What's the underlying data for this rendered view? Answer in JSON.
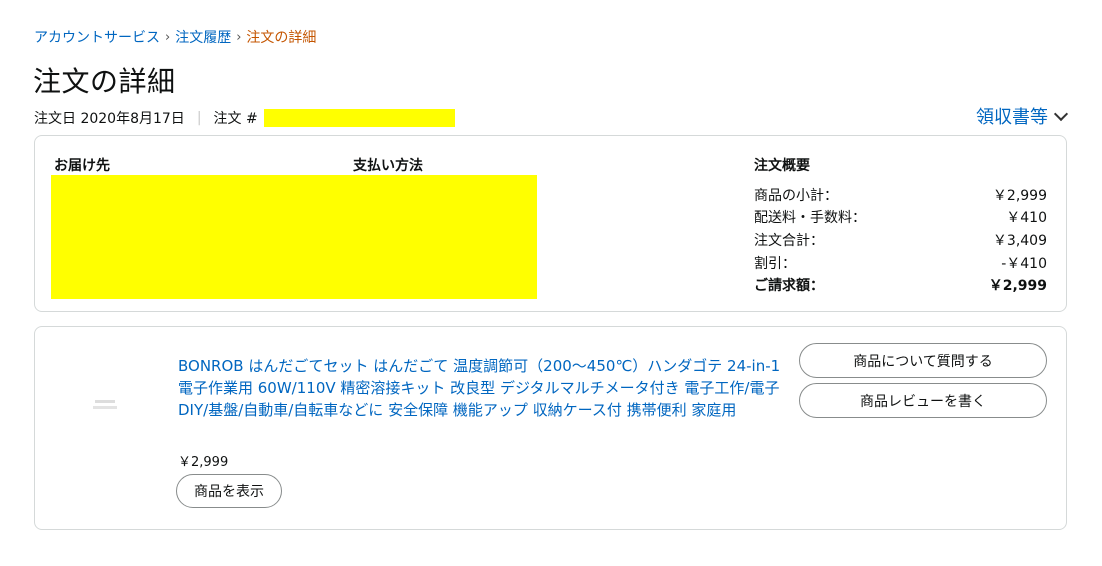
{
  "breadcrumb": {
    "items": [
      "アカウントサービス",
      "注文履歴"
    ],
    "current": "注文の詳細",
    "separator": "›"
  },
  "page": {
    "title": "注文の詳細",
    "order_date": "注文日 2020年8月17日",
    "divider": "|",
    "order_number_label": "注文 #",
    "receipt_label": "領収書等"
  },
  "summary": {
    "shipping_address_label": "お届け先",
    "payment_method_label": "支払い方法",
    "order_summary_label": "注文概要",
    "rows": [
      {
        "label": "商品の小計：",
        "value": "￥2,999"
      },
      {
        "label": "配送料・手数料：",
        "value": "￥410"
      },
      {
        "label": "注文合計：",
        "value": "￥3,409"
      },
      {
        "label": "割引：",
        "value": "-￥410"
      },
      {
        "label": "ご請求額：",
        "value": "￥2,999"
      }
    ]
  },
  "item": {
    "title": "BONROB はんだごてセット はんだごて 温度調節可（200～450℃）ハンダゴテ 24-in-1 電子作業用 60W/110V 精密溶接キット 改良型 デジタルマルチメータ付き 電子工作/電子DIY/基盤/自動車/自転車などに 安全保障 機能アップ 収納ケース付 携帯便利 家庭用",
    "price": "￥2,999",
    "view_button": "商品を表示",
    "question_button": "商品について質問する",
    "review_button": "商品レビューを書く"
  },
  "colors": {
    "link": "#0066c0",
    "breadcrumb_current": "#c45500",
    "redaction": "#ffff00",
    "border": "#d5d9d9"
  }
}
